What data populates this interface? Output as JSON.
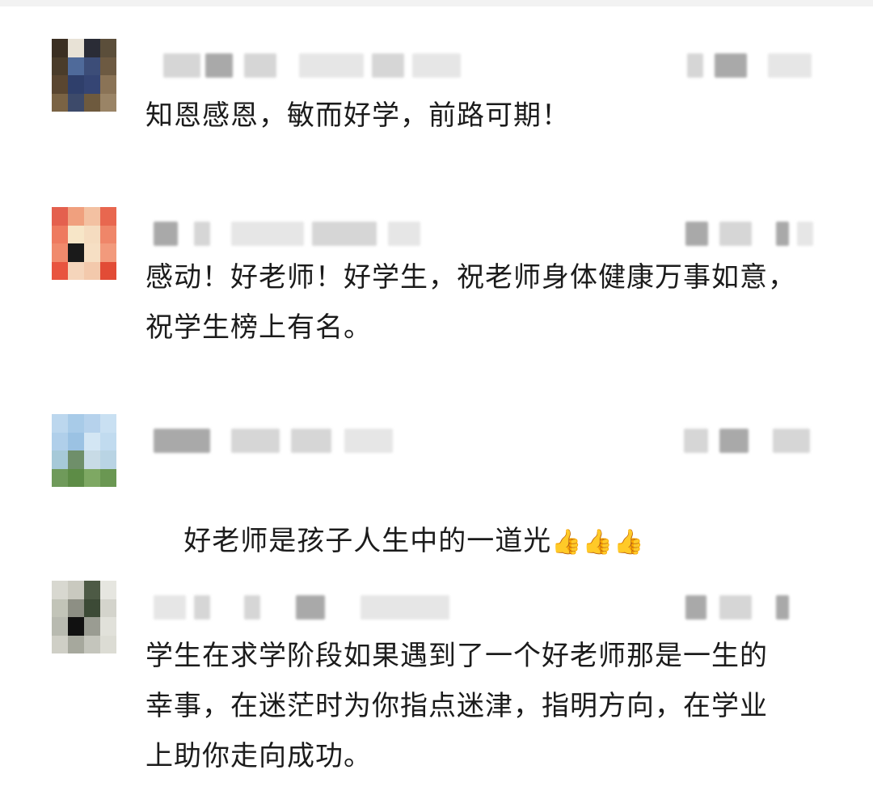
{
  "comments": [
    {
      "text": "知恩感恩，敏而好学，前路可期！"
    },
    {
      "text": "感动！好老师！好学生，祝老师身体健康万事如意，祝学生榜上有名。"
    },
    {
      "text": "好老师是孩子人生中的一道光",
      "emoji": "👍👍👍"
    },
    {
      "text": "学生在求学阶段如果遇到了一个好老师那是一生的幸事，在迷茫时为你指点迷津，指明方向，在学业上助你走向成功。"
    }
  ]
}
